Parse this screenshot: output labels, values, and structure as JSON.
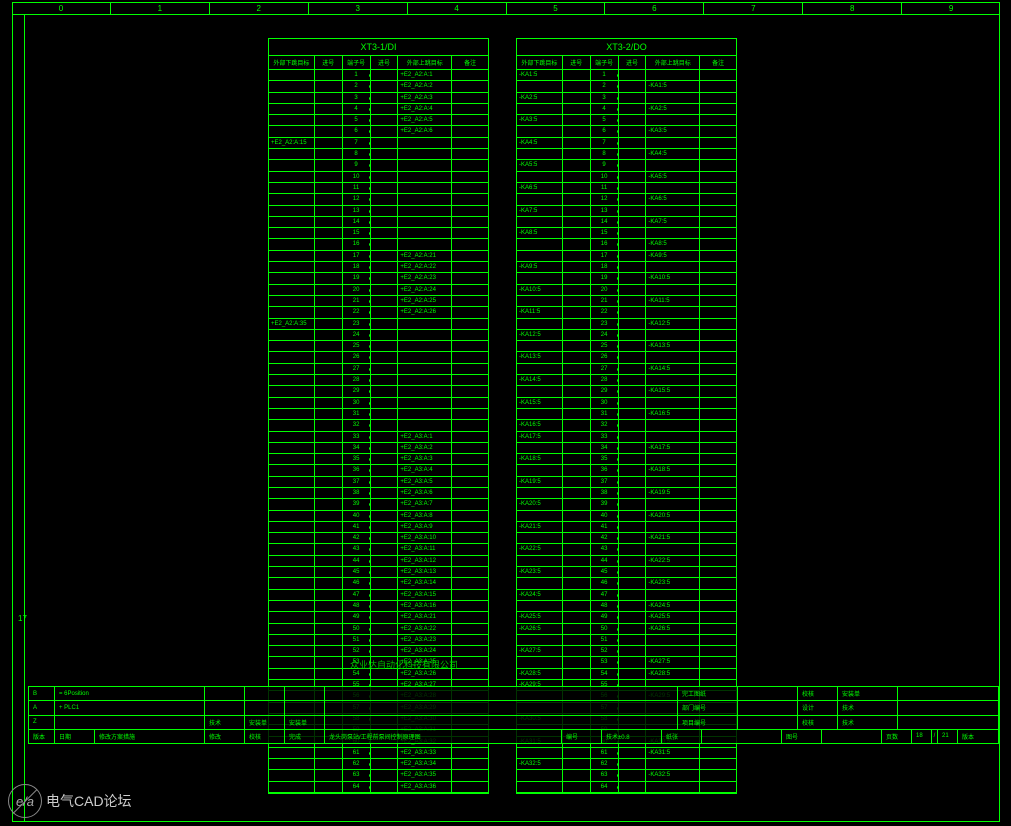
{
  "ruler_top": [
    "0",
    "1",
    "2",
    "3",
    "4",
    "5",
    "6",
    "7",
    "8",
    "9"
  ],
  "left_marker": "17",
  "company_text": "众业达自动化科技有限公司",
  "table_left": {
    "title": "XT3-1/DI",
    "headers": [
      "外部下跳目标",
      "进号",
      "端子号",
      "进号",
      "外部上跳目标",
      "备注"
    ],
    "rows": [
      [
        "",
        "",
        "1",
        "",
        "+E2_A2:A:1",
        ""
      ],
      [
        "",
        "",
        "2",
        "",
        "+E2_A2:A:2",
        ""
      ],
      [
        "",
        "",
        "3",
        "",
        "+E2_A2:A:3",
        ""
      ],
      [
        "",
        "",
        "4",
        "",
        "+E2_A2:A:4",
        ""
      ],
      [
        "",
        "",
        "5",
        "",
        "+E2_A2:A:5",
        ""
      ],
      [
        "",
        "",
        "6",
        "",
        "+E2_A2:A:6",
        ""
      ],
      [
        "+E2_A2:A:15",
        "",
        "7",
        "",
        "",
        ""
      ],
      [
        "",
        "",
        "8",
        "",
        "",
        ""
      ],
      [
        "",
        "",
        "9",
        "",
        "",
        ""
      ],
      [
        "",
        "",
        "10",
        "",
        "",
        ""
      ],
      [
        "",
        "",
        "11",
        "",
        "",
        ""
      ],
      [
        "",
        "",
        "12",
        "",
        "",
        ""
      ],
      [
        "",
        "",
        "13",
        "",
        "",
        ""
      ],
      [
        "",
        "",
        "14",
        "",
        "",
        ""
      ],
      [
        "",
        "",
        "15",
        "",
        "",
        ""
      ],
      [
        "",
        "",
        "16",
        "",
        "",
        ""
      ],
      [
        "",
        "",
        "17",
        "",
        "+E2_A2:A:21",
        ""
      ],
      [
        "",
        "",
        "18",
        "",
        "+E2_A2:A:22",
        ""
      ],
      [
        "",
        "",
        "19",
        "",
        "+E2_A2:A:23",
        ""
      ],
      [
        "",
        "",
        "20",
        "",
        "+E2_A2:A:24",
        ""
      ],
      [
        "",
        "",
        "21",
        "",
        "+E2_A2:A:25",
        ""
      ],
      [
        "",
        "",
        "22",
        "",
        "+E2_A2:A:26",
        ""
      ],
      [
        "+E2_A2:A:35",
        "",
        "23",
        "",
        "",
        ""
      ],
      [
        "",
        "",
        "24",
        "",
        "",
        ""
      ],
      [
        "",
        "",
        "25",
        "",
        "",
        ""
      ],
      [
        "",
        "",
        "26",
        "",
        "",
        ""
      ],
      [
        "",
        "",
        "27",
        "",
        "",
        ""
      ],
      [
        "",
        "",
        "28",
        "",
        "",
        ""
      ],
      [
        "",
        "",
        "29",
        "",
        "",
        ""
      ],
      [
        "",
        "",
        "30",
        "",
        "",
        ""
      ],
      [
        "",
        "",
        "31",
        "",
        "",
        ""
      ],
      [
        "",
        "",
        "32",
        "",
        "",
        ""
      ],
      [
        "",
        "",
        "33",
        "",
        "+E2_A3:A:1",
        ""
      ],
      [
        "",
        "",
        "34",
        "",
        "+E2_A3:A:2",
        ""
      ],
      [
        "",
        "",
        "35",
        "",
        "+E2_A3:A:3",
        ""
      ],
      [
        "",
        "",
        "36",
        "",
        "+E2_A3:A:4",
        ""
      ],
      [
        "",
        "",
        "37",
        "",
        "+E2_A3:A:5",
        ""
      ],
      [
        "",
        "",
        "38",
        "",
        "+E2_A3:A:6",
        ""
      ],
      [
        "",
        "",
        "39",
        "",
        "+E2_A3:A:7",
        ""
      ],
      [
        "",
        "",
        "40",
        "",
        "+E2_A3:A:8",
        ""
      ],
      [
        "",
        "",
        "41",
        "",
        "+E2_A3:A:9",
        ""
      ],
      [
        "",
        "",
        "42",
        "",
        "+E2_A3:A:10",
        ""
      ],
      [
        "",
        "",
        "43",
        "",
        "+E2_A3:A:11",
        ""
      ],
      [
        "",
        "",
        "44",
        "",
        "+E2_A3:A:12",
        ""
      ],
      [
        "",
        "",
        "45",
        "",
        "+E2_A3:A:13",
        ""
      ],
      [
        "",
        "",
        "46",
        "",
        "+E2_A3:A:14",
        ""
      ],
      [
        "",
        "",
        "47",
        "",
        "+E2_A3:A:15",
        ""
      ],
      [
        "",
        "",
        "48",
        "",
        "+E2_A3:A:16",
        ""
      ],
      [
        "",
        "",
        "49",
        "",
        "+E2_A3:A:21",
        ""
      ],
      [
        "",
        "",
        "50",
        "",
        "+E2_A3:A:22",
        ""
      ],
      [
        "",
        "",
        "51",
        "",
        "+E2_A3:A:23",
        ""
      ],
      [
        "",
        "",
        "52",
        "",
        "+E2_A3:A:24",
        ""
      ],
      [
        "",
        "",
        "53",
        "",
        "+E2_A3:A:25",
        ""
      ],
      [
        "",
        "",
        "54",
        "",
        "+E2_A3:A:26",
        ""
      ],
      [
        "",
        "",
        "55",
        "",
        "+E2_A3:A:27",
        ""
      ],
      [
        "",
        "",
        "56",
        "",
        "+E2_A3:A:28",
        ""
      ],
      [
        "",
        "",
        "57",
        "",
        "+E2_A3:A:29",
        ""
      ],
      [
        "",
        "",
        "58",
        "",
        "+E2_A3:A:30",
        ""
      ],
      [
        "",
        "",
        "59",
        "",
        "+E2_A3:A:31",
        ""
      ],
      [
        "",
        "",
        "60",
        "",
        "+E2_A3:A:32",
        ""
      ],
      [
        "",
        "",
        "61",
        "",
        "+E2_A3:A:33",
        ""
      ],
      [
        "",
        "",
        "62",
        "",
        "+E2_A3:A:34",
        ""
      ],
      [
        "",
        "",
        "63",
        "",
        "+E2_A3:A:35",
        ""
      ],
      [
        "",
        "",
        "64",
        "",
        "+E2_A3:A:36",
        ""
      ]
    ]
  },
  "table_right": {
    "title": "XT3-2/DO",
    "headers": [
      "外部下跳目标",
      "进号",
      "端子号",
      "进号",
      "外部上跳目标",
      "备注"
    ],
    "rows": [
      [
        "-KA1:5",
        "",
        "1",
        "",
        "",
        ""
      ],
      [
        "",
        "",
        "2",
        "",
        "-KA1:5",
        ""
      ],
      [
        "-KA2:5",
        "",
        "3",
        "",
        "",
        ""
      ],
      [
        "",
        "",
        "4",
        "",
        "-KA2:5",
        ""
      ],
      [
        "-KA3:5",
        "",
        "5",
        "",
        "",
        ""
      ],
      [
        "",
        "",
        "6",
        "",
        "-KA3:5",
        ""
      ],
      [
        "-KA4:5",
        "",
        "7",
        "",
        "",
        ""
      ],
      [
        "",
        "",
        "8",
        "",
        "-KA4:5",
        ""
      ],
      [
        "-KA5:5",
        "",
        "9",
        "",
        "",
        ""
      ],
      [
        "",
        "",
        "10",
        "",
        "-KA5:5",
        ""
      ],
      [
        "-KA6:5",
        "",
        "11",
        "",
        "",
        ""
      ],
      [
        "",
        "",
        "12",
        "",
        "-KA6:5",
        ""
      ],
      [
        "-KA7:5",
        "",
        "13",
        "",
        "",
        ""
      ],
      [
        "",
        "",
        "14",
        "",
        "-KA7:5",
        ""
      ],
      [
        "-KA8:5",
        "",
        "15",
        "",
        "",
        ""
      ],
      [
        "",
        "",
        "16",
        "",
        "-KA8:5",
        ""
      ],
      [
        "",
        "",
        "17",
        "",
        "-KA9:5",
        ""
      ],
      [
        "-KA9:5",
        "",
        "18",
        "",
        "",
        ""
      ],
      [
        "",
        "",
        "19",
        "",
        "-KA10:5",
        ""
      ],
      [
        "-KA10:5",
        "",
        "20",
        "",
        "",
        ""
      ],
      [
        "",
        "",
        "21",
        "",
        "-KA11:5",
        ""
      ],
      [
        "-KA11:5",
        "",
        "22",
        "",
        "",
        ""
      ],
      [
        "",
        "",
        "23",
        "",
        "-KA12:5",
        ""
      ],
      [
        "-KA12:5",
        "",
        "24",
        "",
        "",
        ""
      ],
      [
        "",
        "",
        "25",
        "",
        "-KA13:5",
        ""
      ],
      [
        "-KA13:5",
        "",
        "26",
        "",
        "",
        ""
      ],
      [
        "",
        "",
        "27",
        "",
        "-KA14:5",
        ""
      ],
      [
        "-KA14:5",
        "",
        "28",
        "",
        "",
        ""
      ],
      [
        "",
        "",
        "29",
        "",
        "-KA15:5",
        ""
      ],
      [
        "-KA15:5",
        "",
        "30",
        "",
        "",
        ""
      ],
      [
        "",
        "",
        "31",
        "",
        "-KA16:5",
        ""
      ],
      [
        "-KA16:5",
        "",
        "32",
        "",
        "",
        ""
      ],
      [
        "-KA17:5",
        "",
        "33",
        "",
        "",
        ""
      ],
      [
        "",
        "",
        "34",
        "",
        "-KA17:5",
        ""
      ],
      [
        "-KA18:5",
        "",
        "35",
        "",
        "",
        ""
      ],
      [
        "",
        "",
        "36",
        "",
        "-KA18:5",
        ""
      ],
      [
        "-KA19:5",
        "",
        "37",
        "",
        "",
        ""
      ],
      [
        "",
        "",
        "38",
        "",
        "-KA19:5",
        ""
      ],
      [
        "-KA20:5",
        "",
        "39",
        "",
        "",
        ""
      ],
      [
        "",
        "",
        "40",
        "",
        "-KA20:5",
        ""
      ],
      [
        "-KA21:5",
        "",
        "41",
        "",
        "",
        ""
      ],
      [
        "",
        "",
        "42",
        "",
        "-KA21:5",
        ""
      ],
      [
        "-KA22:5",
        "",
        "43",
        "",
        "",
        ""
      ],
      [
        "",
        "",
        "44",
        "",
        "-KA22:5",
        ""
      ],
      [
        "-KA23:5",
        "",
        "45",
        "",
        "",
        ""
      ],
      [
        "",
        "",
        "46",
        "",
        "-KA23:5",
        ""
      ],
      [
        "-KA24:5",
        "",
        "47",
        "",
        "",
        ""
      ],
      [
        "",
        "",
        "48",
        "",
        "-KA24:5",
        ""
      ],
      [
        "-KA25:5",
        "",
        "49",
        "",
        "-KA25:5",
        ""
      ],
      [
        "-KA26:5",
        "",
        "50",
        "",
        "-KA26:5",
        ""
      ],
      [
        "",
        "",
        "51",
        "",
        "",
        ""
      ],
      [
        "-KA27:5",
        "",
        "52",
        "",
        "",
        ""
      ],
      [
        "",
        "",
        "53",
        "",
        "-KA27:5",
        ""
      ],
      [
        "-KA28:5",
        "",
        "54",
        "",
        "-KA28:5",
        ""
      ],
      [
        "-KA29:5",
        "",
        "55",
        "",
        "",
        ""
      ],
      [
        "",
        "",
        "56",
        "",
        "-KA29:5",
        ""
      ],
      [
        "",
        "",
        "57",
        "",
        "",
        ""
      ],
      [
        "-KA30:5",
        "",
        "58",
        "",
        "",
        ""
      ],
      [
        "",
        "",
        "59",
        "",
        "",
        ""
      ],
      [
        "-KA31:5",
        "",
        "60",
        "",
        "-KA30:5",
        ""
      ],
      [
        "",
        "",
        "61",
        "",
        "-KA31:5",
        ""
      ],
      [
        "-KA32:5",
        "",
        "62",
        "",
        "",
        ""
      ],
      [
        "",
        "",
        "63",
        "",
        "-KA32:5",
        ""
      ],
      [
        "",
        "",
        "64",
        "",
        "",
        ""
      ]
    ]
  },
  "titleblock": {
    "r1": {
      "a": "B",
      "b": "= 6Position",
      "c": "",
      "d": "",
      "e": "",
      "f": "",
      "g": "完工图纸",
      "h": "",
      "i": "校核",
      "j": "安装单"
    },
    "r2": {
      "a": "A",
      "b": "+ PLC1",
      "c": "",
      "d": "",
      "e": "",
      "f": "",
      "g": "部门编号",
      "h": "",
      "i": "设计",
      "j": "技术"
    },
    "r3": {
      "a": "Z",
      "b": "",
      "c": "技术",
      "d": "安装单",
      "e": "安装单",
      "f": "",
      "g": "项目编号",
      "h": "",
      "i": "校核",
      "j": "技术"
    },
    "r4": {
      "a": "版本",
      "b": "日期",
      "c": "修改方案措施",
      "d": "修改",
      "e": "校核",
      "f": "完成",
      "note": "龙头岗泵站/工程前泵间控制原理图",
      "g": "编号",
      "h": "技术±0.8",
      "i": "纸张",
      "j": "图号",
      "k": "页数",
      "l": "18",
      "m": "21",
      "n": "版本"
    }
  },
  "watermark": {
    "logo": "e/a",
    "text": "电气CAD论坛"
  }
}
